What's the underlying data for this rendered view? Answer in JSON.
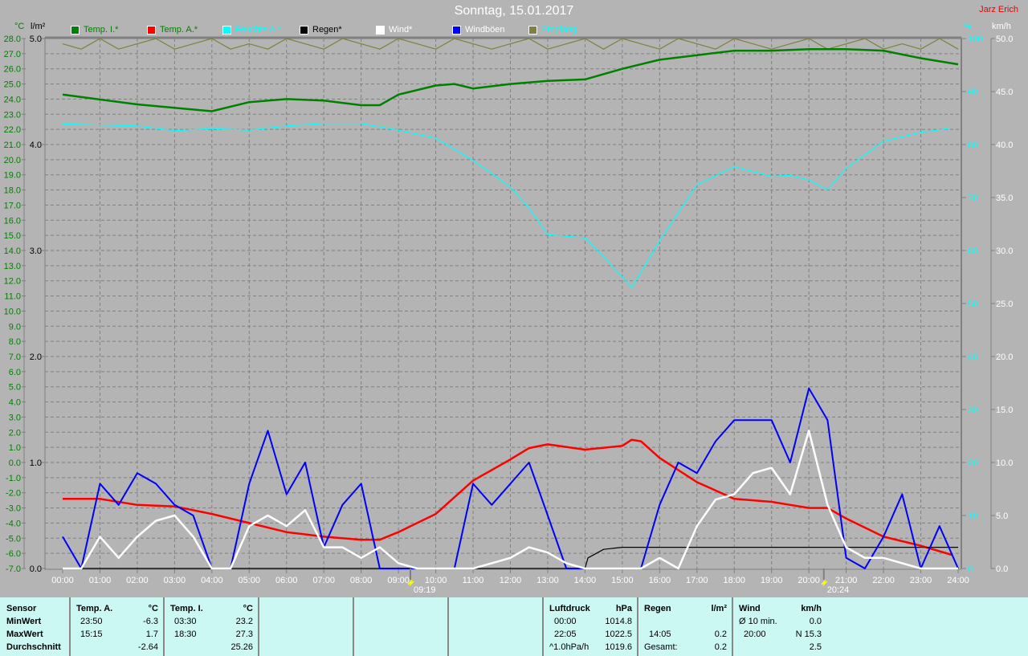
{
  "title": "Sonntag, 15.01.2017",
  "author": "Jarz Erich",
  "colors": {
    "temp_i": "#008000",
    "temp_a": "#ff0000",
    "feuchte": "#00ffff",
    "regen": "#000000",
    "wind": "#ffffff",
    "boeen": "#0000ff",
    "empfang": "#808040"
  },
  "units": {
    "celsius": "°C",
    "rain": "l/m²",
    "percent": "%",
    "kmh": "km/h"
  },
  "chart_data": {
    "type": "line",
    "title": "Sonntag, 15.01.2017",
    "x_unit": "hours",
    "xlim": [
      0,
      24
    ],
    "x_tick_labels": [
      "00:00",
      "01:00",
      "02:00",
      "03:00",
      "04:00",
      "05:00",
      "06:00",
      "07:00",
      "08:00",
      "09:00",
      "10:00",
      "11:00",
      "12:00",
      "13:00",
      "14:00",
      "15:00",
      "16:00",
      "17:00",
      "18:00",
      "19:00",
      "20:00",
      "21:00",
      "22:00",
      "23:00",
      "24:00"
    ],
    "axes": {
      "celsius": {
        "range": [
          -7,
          28
        ],
        "ticks": [
          "28.0",
          "27.0",
          "26.0",
          "25.0",
          "24.0",
          "23.0",
          "22.0",
          "21.0",
          "20.0",
          "19.0",
          "18.0",
          "17.0",
          "16.0",
          "15.0",
          "14.0",
          "13.0",
          "12.0",
          "11.0",
          "10.0",
          "9.0",
          "8.0",
          "7.0",
          "6.0",
          "5.0",
          "4.0",
          "3.0",
          "2.0",
          "1.0",
          "0.0",
          "-1.0",
          "-2.0",
          "-3.0",
          "-4.0",
          "-5.0",
          "-6.0",
          "-7.0"
        ]
      },
      "rain": {
        "range": [
          0,
          5
        ],
        "ticks": [
          "5.0",
          "4.0",
          "3.0",
          "2.0",
          "1.0",
          "0.0"
        ]
      },
      "percent": {
        "range": [
          0,
          100
        ],
        "ticks": [
          "100",
          "90",
          "80",
          "70",
          "60",
          "50",
          "40",
          "30",
          "20",
          "10",
          "0"
        ]
      },
      "kmh": {
        "range": [
          0,
          50
        ],
        "ticks": [
          "50.0",
          "45.0",
          "40.0",
          "35.0",
          "30.0",
          "25.0",
          "20.0",
          "15.0",
          "10.0",
          "5.0",
          "0.0"
        ]
      }
    },
    "legend": [
      "Temp. I.*",
      "Temp. A.*",
      "Feuchte A.*",
      "Regen*",
      "Wind*",
      "Windböen",
      "Empfang"
    ],
    "series": [
      {
        "name": "Temp. I.*",
        "axis": "celsius",
        "color": "#008000",
        "x": [
          0,
          2,
          4,
          5,
          6,
          7,
          8,
          8.5,
          9,
          10,
          10.5,
          11,
          12,
          13,
          14,
          15,
          16,
          17,
          18,
          19,
          20,
          21,
          22,
          23,
          24
        ],
        "y": [
          24.3,
          23.65,
          23.2,
          23.8,
          24.0,
          23.9,
          23.6,
          23.6,
          24.3,
          24.9,
          25.0,
          24.7,
          25.0,
          25.2,
          25.3,
          26.0,
          26.6,
          26.9,
          27.2,
          27.2,
          27.3,
          27.3,
          27.2,
          26.7,
          26.3
        ]
      },
      {
        "name": "Temp. A.*",
        "axis": "celsius",
        "color": "#ff0000",
        "x": [
          0,
          1,
          2,
          3,
          4,
          5,
          6,
          7,
          8,
          8.5,
          9,
          10,
          11,
          12,
          12.5,
          13,
          14,
          15,
          15.25,
          15.5,
          16,
          17,
          18,
          19,
          19.5,
          20,
          20.5,
          21,
          22,
          23,
          23.83
        ],
        "y": [
          -2.4,
          -2.4,
          -2.8,
          -2.9,
          -3.4,
          -4.0,
          -4.6,
          -4.9,
          -5.1,
          -5.1,
          -4.6,
          -3.4,
          -1.2,
          0.2,
          0.95,
          1.2,
          0.85,
          1.1,
          1.5,
          1.4,
          0.3,
          -1.3,
          -2.4,
          -2.6,
          -2.8,
          -3.0,
          -3.0,
          -3.7,
          -4.9,
          -5.5,
          -6.1
        ]
      },
      {
        "name": "Feuchte A.*",
        "axis": "percent",
        "color": "#00ffff",
        "x": [
          0,
          2,
          3,
          4,
          5,
          6,
          7,
          8,
          9,
          10,
          11,
          12,
          12.5,
          13,
          14,
          14.5,
          15,
          15.25,
          16,
          17,
          18,
          19,
          19.5,
          20,
          20.5,
          21,
          22,
          23,
          23.75
        ],
        "y": [
          83.9,
          83.5,
          82.6,
          83,
          82.7,
          83.5,
          84,
          84,
          82.7,
          81.2,
          77,
          72,
          68,
          63,
          62.4,
          58.8,
          55,
          53,
          61.8,
          72.4,
          75.8,
          74,
          74.2,
          73.3,
          71.5,
          75.5,
          80.6,
          82.3,
          83
        ]
      },
      {
        "name": "Regen*",
        "axis": "rain",
        "color": "#000000",
        "x": [
          0,
          14.0,
          14.08,
          14.5,
          15,
          24
        ],
        "y": [
          0,
          0,
          0.1,
          0.18,
          0.2,
          0.2
        ]
      },
      {
        "name": "Wind*",
        "axis": "kmh",
        "color": "#ffffff",
        "x": [
          0,
          0.5,
          1,
          1.5,
          2,
          2.5,
          3,
          3.5,
          4,
          4.5,
          5,
          5.5,
          6,
          6.5,
          7,
          7.5,
          8,
          8.5,
          9,
          9.5,
          10,
          10.5,
          11,
          11.5,
          12,
          12.5,
          13,
          13.5,
          14,
          14.5,
          15,
          15.5,
          16,
          16.5,
          17,
          17.5,
          18,
          18.5,
          19,
          19.5,
          20,
          20.5,
          21,
          21.5,
          22,
          22.5,
          23,
          23.5,
          24
        ],
        "y": [
          0,
          0,
          3,
          1,
          3,
          4.5,
          5,
          3,
          0,
          0,
          4,
          5,
          4,
          5.5,
          2,
          2,
          1,
          2,
          0.5,
          0,
          0,
          0,
          0,
          0.5,
          1,
          2,
          1.5,
          0.5,
          0,
          0,
          0,
          0,
          1,
          0,
          4,
          6.5,
          7,
          9,
          9.5,
          7,
          13,
          6,
          2,
          1,
          1,
          0.5,
          0,
          0,
          0
        ]
      },
      {
        "name": "Windböen",
        "axis": "kmh",
        "color": "#0000ff",
        "x": [
          0,
          0.5,
          1,
          1.5,
          2,
          2.5,
          3,
          3.5,
          4,
          4.5,
          5,
          5.5,
          6,
          6.5,
          7,
          7.5,
          8,
          8.5,
          9,
          9.5,
          10,
          10.5,
          11,
          11.5,
          12,
          12.5,
          13,
          13.5,
          14,
          14.5,
          15,
          15.5,
          16,
          16.5,
          17,
          17.5,
          18,
          18.5,
          19,
          19.5,
          20,
          20.5,
          21,
          21.5,
          22,
          22.5,
          23,
          23.5,
          24
        ],
        "y": [
          3,
          0,
          8,
          6,
          9,
          8,
          6,
          5,
          0,
          0,
          8,
          13,
          7,
          10,
          2,
          6,
          8,
          0,
          0,
          0,
          0,
          0,
          8,
          6,
          8,
          10,
          5,
          0,
          0,
          0,
          0,
          0,
          6,
          10,
          9,
          12,
          14,
          14,
          14,
          10,
          17,
          14,
          1,
          0,
          3,
          7,
          0,
          4,
          0
        ]
      },
      {
        "name": "Empfang",
        "axis": "percent",
        "color": "#808040",
        "x": [
          0,
          0.5,
          1,
          1.5,
          2,
          2.5,
          3,
          3.5,
          4,
          4.5,
          5,
          5.5,
          6,
          6.5,
          7,
          7.5,
          8,
          8.5,
          9,
          9.5,
          10,
          10.5,
          11,
          11.5,
          12,
          12.5,
          13,
          13.5,
          14,
          14.5,
          15,
          15.5,
          16,
          16.5,
          17,
          17.5,
          18,
          18.5,
          19,
          19.5,
          20,
          20.5,
          21,
          21.5,
          22,
          22.5,
          23,
          23.5,
          24
        ],
        "y": [
          99,
          98,
          100,
          98,
          99,
          100,
          98,
          99,
          100,
          98,
          99,
          98,
          100,
          99,
          98,
          100,
          99,
          98,
          100,
          99,
          98,
          100,
          99,
          98,
          99,
          100,
          98,
          99,
          100,
          98,
          100,
          99,
          98,
          100,
          99,
          98,
          100,
          99,
          98,
          99,
          100,
          98,
          99,
          100,
          98,
          99,
          98,
          100,
          98
        ]
      }
    ],
    "annotations": [
      {
        "label": "09:19",
        "type": "sunrise",
        "x": 9.32
      },
      {
        "label": "20:24",
        "type": "sunset",
        "x": 20.4
      }
    ]
  },
  "table": {
    "sensor": {
      "header": "Sensor",
      "rows": [
        "MinWert",
        "MaxWert",
        "Durchschnitt"
      ]
    },
    "temp_a": {
      "header": "Temp. A.",
      "unit": "°C",
      "min_time": "23:50",
      "min": "-6.3",
      "max_time": "15:15",
      "max": "1.7",
      "avg": "-2.64"
    },
    "temp_i": {
      "header": "Temp. I.",
      "unit": "°C",
      "min_time": "03:30",
      "min": "23.2",
      "max_time": "18:30",
      "max": "27.3",
      "avg": "25.26"
    },
    "luftdruck": {
      "header": "Luftdruck",
      "unit": "hPa",
      "min_time": "00:00",
      "min": "1014.8",
      "max_time": "22:05",
      "max": "1022.5",
      "trend": "^1.0hPa/h",
      "avg": "1019.6"
    },
    "regen": {
      "header": "Regen",
      "unit": "l/m²",
      "max_time": "14:05",
      "max": "0.2",
      "total_label": "Gesamt:",
      "total": "0.2"
    },
    "wind": {
      "header": "Wind",
      "unit": "km/h",
      "avg10_label": "Ø 10 min.",
      "avg10": "0.0",
      "max_time": "20:00",
      "max": "N 15.3",
      "avg": "2.5"
    }
  }
}
